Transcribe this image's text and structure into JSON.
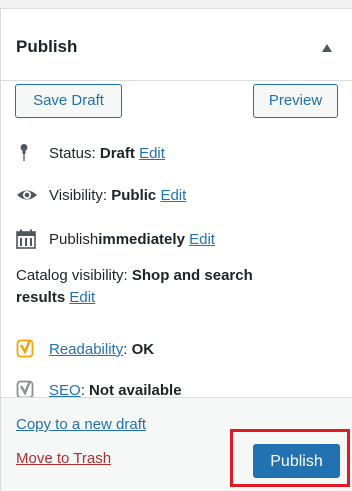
{
  "panel": {
    "title": "Publish",
    "save_draft_label": "Save Draft",
    "preview_label": "Preview",
    "status": {
      "label": "Status: ",
      "value": "Draft",
      "edit": "Edit",
      "icon": "pin-icon"
    },
    "visibility": {
      "label": "Visibility: ",
      "value": "Public",
      "edit": "Edit",
      "icon": "eye-icon"
    },
    "publish_time": {
      "label": "Publish ",
      "value": "immediately",
      "edit": "Edit",
      "icon": "calendar-icon"
    },
    "catalog": {
      "label": "Catalog visibility: ",
      "value": "Shop and search results",
      "edit": "Edit"
    },
    "readability": {
      "link": "Readability",
      "sep": ": ",
      "value": "OK",
      "icon": "yoast-icon",
      "color": "#f0a500"
    },
    "seo": {
      "link": "SEO",
      "sep": ": ",
      "value": "Not available",
      "icon": "yoast-icon",
      "color": "#8c8f94"
    }
  },
  "footer": {
    "copy_label": "Copy to a new draft",
    "trash_label": "Move to Trash",
    "publish_label": "Publish"
  },
  "colors": {
    "accent": "#2271b1",
    "danger": "#b32d2e",
    "highlight": "#e01b24"
  }
}
